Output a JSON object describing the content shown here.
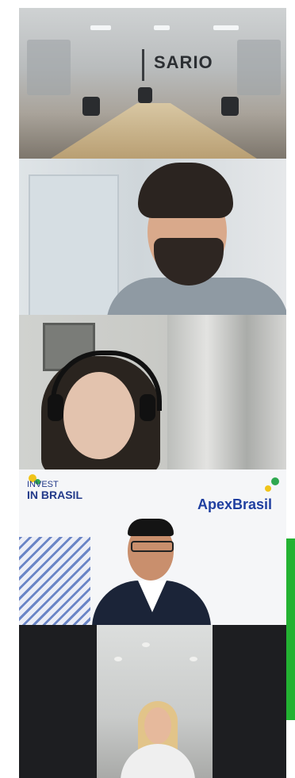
{
  "participants": [
    {
      "id": "p1",
      "wall_logo": "SARIO"
    },
    {
      "id": "p2"
    },
    {
      "id": "p3"
    },
    {
      "id": "p4",
      "background": {
        "invest_line1": "INVEST",
        "invest_line2": "IN BRASIL",
        "apex": "ApexBrasil"
      }
    },
    {
      "id": "p5"
    }
  ],
  "colors": {
    "active_speaker_indicator": "#23b232",
    "apex_blue": "#1f3fa0"
  }
}
